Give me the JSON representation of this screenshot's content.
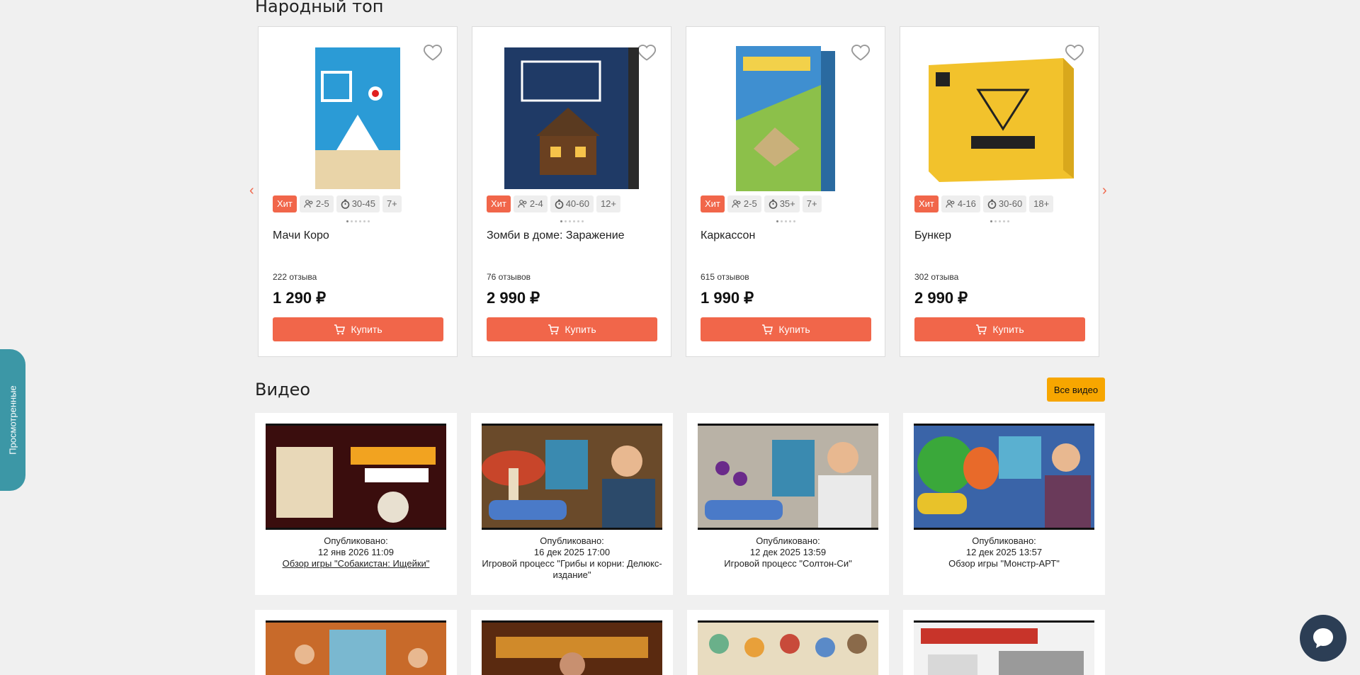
{
  "top_section": {
    "title": "Народный топ"
  },
  "products": [
    {
      "badge": "Хит",
      "players": "2-5",
      "time": "30-45",
      "age": "7+",
      "name": "Мачи Коро",
      "reviews": "222 отзыва",
      "price": "1 290 ₽",
      "buy": "Купить",
      "cover_color": "#2b9bd6"
    },
    {
      "badge": "Хит",
      "players": "2-4",
      "time": "40-60",
      "age": "12+",
      "name": "Зомби в доме: Заражение",
      "reviews": "76 отзывов",
      "price": "2 990 ₽",
      "buy": "Купить",
      "cover_color": "#1f3a66"
    },
    {
      "badge": "Хит",
      "players": "2-5",
      "time": "35+",
      "age": "7+",
      "name": "Каркассон",
      "reviews": "615 отзывов",
      "price": "1 990 ₽",
      "buy": "Купить",
      "cover_color": "#3f8fd0"
    },
    {
      "badge": "Хит",
      "players": "4-16",
      "time": "30-60",
      "age": "18+",
      "name": "Бункер",
      "reviews": "302 отзыва",
      "price": "2 990 ₽",
      "buy": "Купить",
      "cover_color": "#f2c22c"
    }
  ],
  "video_section": {
    "title": "Видео",
    "all_videos": "Все видео"
  },
  "videos": [
    {
      "published_label": "Опубликовано:",
      "date": "12 янв 2026 11:09",
      "title": "Обзор игры \"Собакистан: Ищейки\"",
      "thumb_color": "#3a0d0d"
    },
    {
      "published_label": "Опубликовано:",
      "date": "16 дек 2025 17:00",
      "title": "Игровой процесс \"Грибы и корни: Делюкс-издание\"",
      "thumb_color": "#6a4a2a"
    },
    {
      "published_label": "Опубликовано:",
      "date": "12 дек 2025 13:59",
      "title": "Игровой процесс \"Солтон-Си\"",
      "thumb_color": "#b9b2a6"
    },
    {
      "published_label": "Опубликовано:",
      "date": "12 дек 2025 13:57",
      "title": "Обзор игры \"Монстр-АРТ\"",
      "thumb_color": "#3a64a8"
    }
  ],
  "videos_row2": [
    {
      "thumb_color": "#c86a2a"
    },
    {
      "thumb_color": "#5a2a10"
    },
    {
      "thumb_color": "#e8dcc0"
    },
    {
      "thumb_color": "#f2f2f2"
    }
  ],
  "sidebar": {
    "viewed_label": "Просмотренные"
  },
  "colors": {
    "accent": "#f1664a",
    "video_button": "#f7a600",
    "sidebar_tab": "#3c97a6",
    "chat": "#2c3e55"
  }
}
